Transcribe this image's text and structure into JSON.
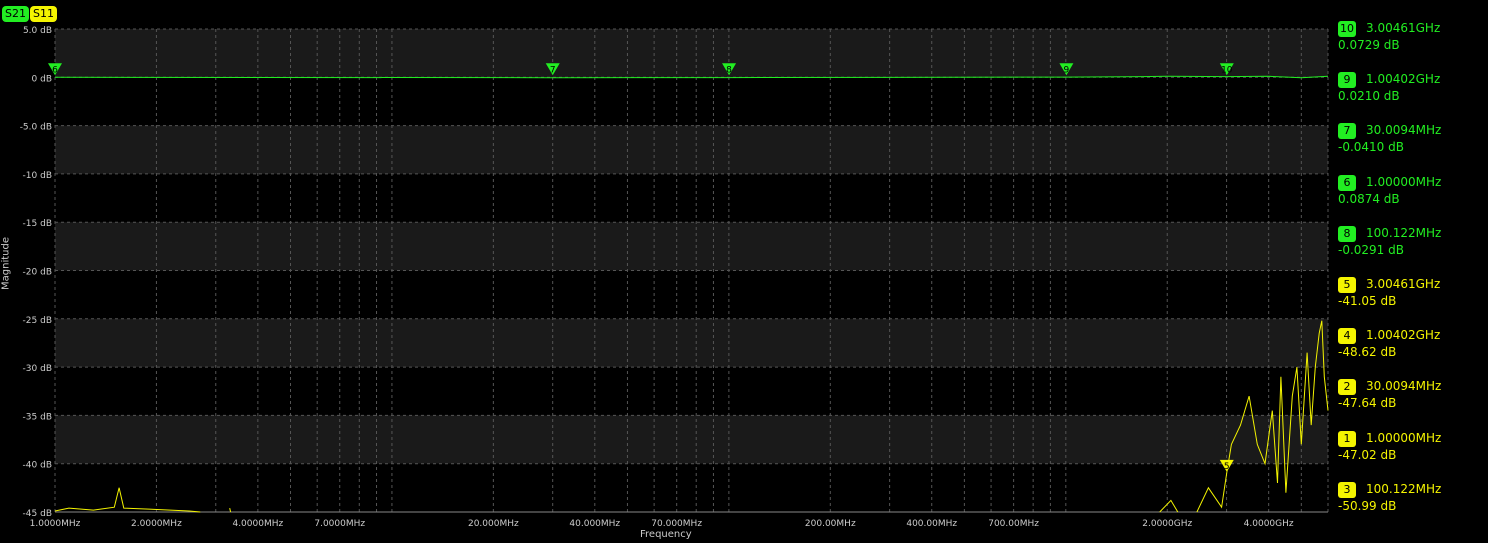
{
  "badges": {
    "s21": "S21",
    "s11": "S11"
  },
  "axis": {
    "ylabel": "Magnitude",
    "xlabel": "Frequency"
  },
  "chart_data": {
    "type": "line",
    "xscale": "log",
    "xlim": [
      "1.0000MHz",
      "6.0000GHz"
    ],
    "ylim": [
      -45,
      5
    ],
    "ylabel": "Magnitude",
    "xlabel": "Frequency",
    "yticks": [
      {
        "v": 5,
        "label": "5.0 dB"
      },
      {
        "v": 0,
        "label": "0 dB"
      },
      {
        "v": -5,
        "label": "-5.0 dB"
      },
      {
        "v": -10,
        "label": "-10 dB"
      },
      {
        "v": -15,
        "label": "-15 dB"
      },
      {
        "v": -20,
        "label": "-20 dB"
      },
      {
        "v": -25,
        "label": "-25 dB"
      },
      {
        "v": -30,
        "label": "-30 dB"
      },
      {
        "v": -35,
        "label": "-35 dB"
      },
      {
        "v": -40,
        "label": "-40 dB"
      },
      {
        "v": -45,
        "label": "-45 dB"
      }
    ],
    "xticks": [
      {
        "mhz": 1,
        "label": "1.0000MHz"
      },
      {
        "mhz": 2,
        "label": "2.0000MHz"
      },
      {
        "mhz": 4,
        "label": "4.0000MHz"
      },
      {
        "mhz": 7,
        "label": "7.0000MHz"
      },
      {
        "mhz": 20,
        "label": "20.000MHz"
      },
      {
        "mhz": 40,
        "label": "40.000MHz"
      },
      {
        "mhz": 70,
        "label": "70.000MHz"
      },
      {
        "mhz": 200,
        "label": "200.00MHz"
      },
      {
        "mhz": 400,
        "label": "400.00MHz"
      },
      {
        "mhz": 700,
        "label": "700.00MHz"
      },
      {
        "mhz": 2000,
        "label": "2.0000GHz"
      },
      {
        "mhz": 4000,
        "label": "4.0000GHz"
      }
    ],
    "series": [
      {
        "name": "S21",
        "color": "#22ee22",
        "points": [
          [
            1,
            0
          ],
          [
            30,
            -0.04
          ],
          [
            100,
            -0.03
          ],
          [
            1000,
            0.02
          ],
          [
            1500,
            0.05
          ],
          [
            2000,
            0.1
          ],
          [
            3000,
            0.07
          ],
          [
            4000,
            0.1
          ],
          [
            5000,
            -0.05
          ],
          [
            6000,
            0.1
          ]
        ]
      },
      {
        "name": "S11",
        "color": "#f4f400",
        "segments": [
          [
            [
              1,
              -44.9
            ],
            [
              1.1,
              -44.6
            ],
            [
              1.3,
              -44.8
            ],
            [
              1.5,
              -44.5
            ],
            [
              1.55,
              -42.5
            ],
            [
              1.6,
              -44.6
            ],
            [
              1.9,
              -44.7
            ],
            [
              2.2,
              -44.8
            ],
            [
              2.5,
              -44.9
            ],
            [
              2.7,
              -45
            ]
          ],
          [
            [
              3.3,
              -44.6
            ],
            [
              3.32,
              -45
            ]
          ],
          [
            [
              1900,
              -45
            ],
            [
              2050,
              -43.8
            ],
            [
              2150,
              -45
            ]
          ],
          [
            [
              2450,
              -45
            ],
            [
              2650,
              -42.5
            ],
            [
              2900,
              -44.5
            ],
            [
              3000,
              -41.05
            ],
            [
              3100,
              -38
            ],
            [
              3300,
              -36
            ],
            [
              3500,
              -33
            ],
            [
              3700,
              -38
            ],
            [
              3900,
              -40
            ],
            [
              4100,
              -34.5
            ],
            [
              4250,
              -42
            ],
            [
              4350,
              -31
            ],
            [
              4500,
              -43
            ],
            [
              4700,
              -33
            ],
            [
              4850,
              -30
            ],
            [
              5000,
              -38
            ],
            [
              5200,
              -28.5
            ],
            [
              5350,
              -36
            ],
            [
              5500,
              -30
            ],
            [
              5650,
              -26.5
            ],
            [
              5750,
              -25.2
            ],
            [
              5850,
              -31
            ],
            [
              6000,
              -34.5
            ]
          ]
        ]
      }
    ],
    "trace_markers": [
      {
        "label": "6",
        "mhz": 1,
        "color": "#22ee22"
      },
      {
        "label": "7",
        "mhz": 30.0094,
        "color": "#22ee22"
      },
      {
        "label": "8",
        "mhz": 100.122,
        "color": "#22ee22"
      },
      {
        "label": "9",
        "mhz": 1004.02,
        "color": "#22ee22"
      },
      {
        "label": "10",
        "mhz": 3004.61,
        "color": "#22ee22"
      },
      {
        "label": "5",
        "mhz": 3004.61,
        "db": -41.05,
        "color": "#f4f400"
      }
    ]
  },
  "marker_table": [
    {
      "num": "10",
      "freq": "3.00461GHz",
      "val": "0.0729 dB",
      "color": "green"
    },
    {
      "num": "9",
      "freq": "1.00402GHz",
      "val": "0.0210 dB",
      "color": "green"
    },
    {
      "num": "7",
      "freq": "30.0094MHz",
      "val": "-0.0410 dB",
      "color": "green"
    },
    {
      "num": "6",
      "freq": "1.00000MHz",
      "val": "0.0874 dB",
      "color": "green"
    },
    {
      "num": "8",
      "freq": "100.122MHz",
      "val": "-0.0291 dB",
      "color": "green"
    },
    {
      "num": "5",
      "freq": "3.00461GHz",
      "val": "-41.05 dB",
      "color": "yellow"
    },
    {
      "num": "4",
      "freq": "1.00402GHz",
      "val": "-48.62 dB",
      "color": "yellow"
    },
    {
      "num": "2",
      "freq": "30.0094MHz",
      "val": "-47.64 dB",
      "color": "yellow"
    },
    {
      "num": "1",
      "freq": "1.00000MHz",
      "val": "-47.02 dB",
      "color": "yellow"
    },
    {
      "num": "3",
      "freq": "100.122MHz",
      "val": "-50.99 dB",
      "color": "yellow"
    }
  ]
}
